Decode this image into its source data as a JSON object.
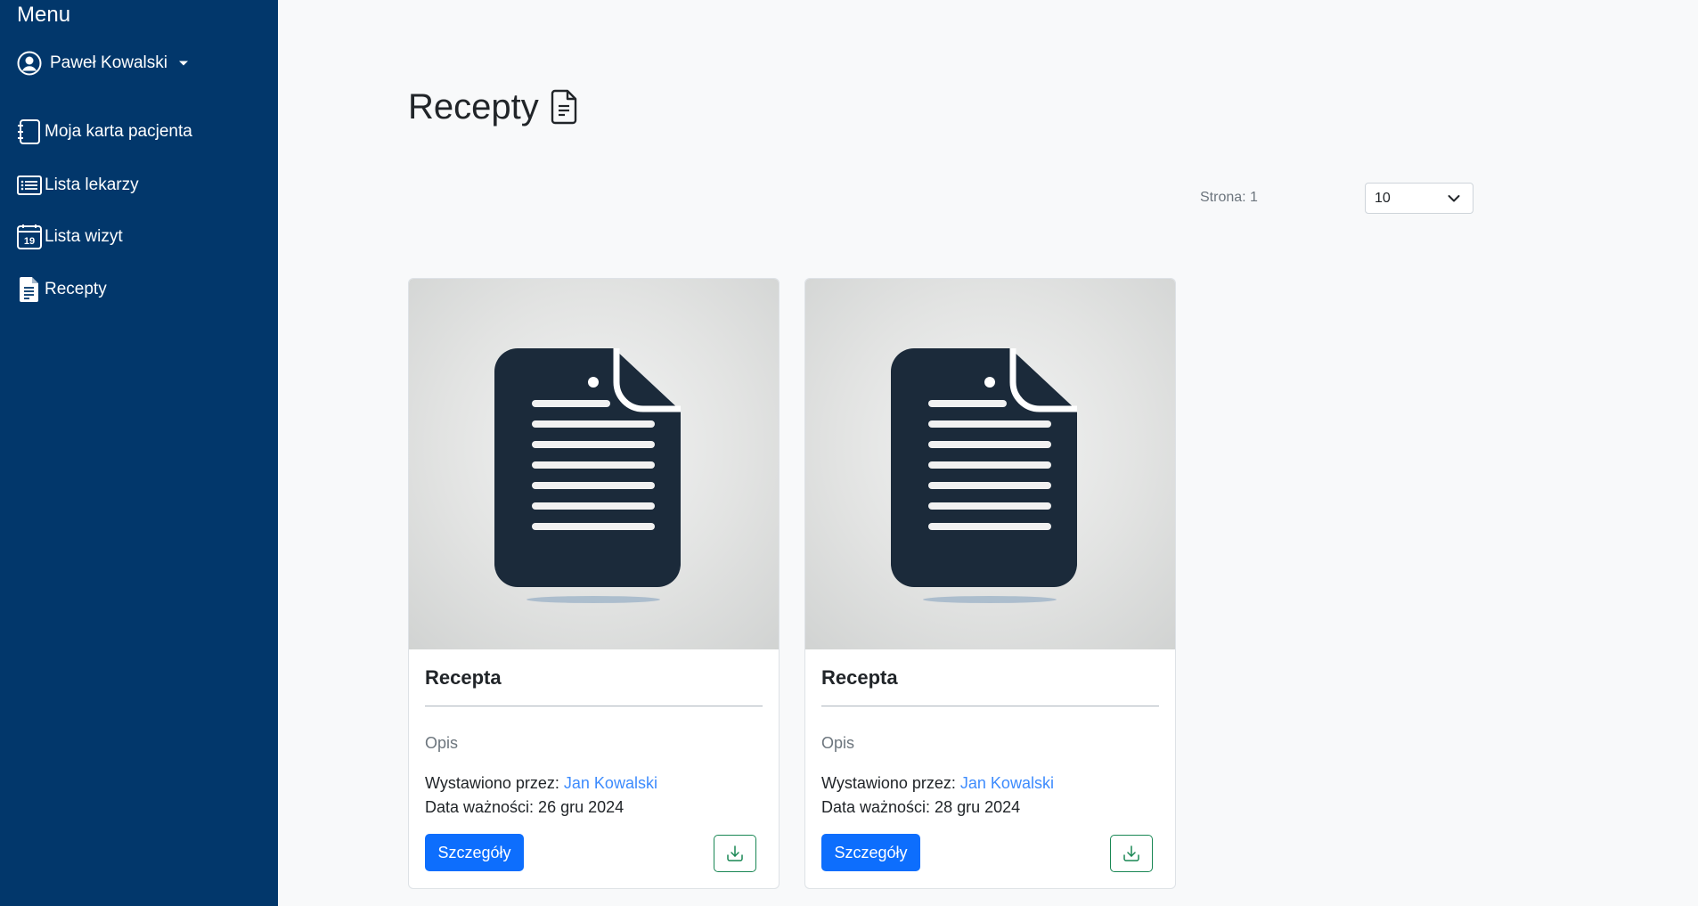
{
  "sidebar": {
    "title": "Menu",
    "user": {
      "name": "Paweł Kowalski"
    },
    "items": [
      {
        "label": "Moja karta pacjenta",
        "icon": "journal-icon"
      },
      {
        "label": "Lista lekarzy",
        "icon": "list-icon"
      },
      {
        "label": "Lista wizyt",
        "icon": "calendar-icon",
        "icon_text": "19"
      },
      {
        "label": "Recepty",
        "icon": "file-text-icon"
      }
    ]
  },
  "main": {
    "title": "Recepty",
    "title_icon": "file-text-icon",
    "pagination": {
      "page_label": "Strona: 1",
      "page_size": "10"
    },
    "prescriptions": [
      {
        "title": "Recepta",
        "description": "Opis",
        "issued_by_label": "Wystawiono przez:",
        "doctor": "Jan Kowalski",
        "expiry": "Data ważności: 26 gru 2024",
        "details_label": "Szczegóły",
        "download_icon": "download-icon"
      },
      {
        "title": "Recepta",
        "description": "Opis",
        "issued_by_label": "Wystawiono przez:",
        "doctor": "Jan Kowalski",
        "expiry": "Data ważności: 28 gru 2024",
        "details_label": "Szczegóły",
        "download_icon": "download-icon"
      }
    ]
  },
  "colors": {
    "sidebar_bg": "#02376b",
    "primary": "#0d6efd",
    "link": "#3d8bfd",
    "success_outline": "#198754",
    "page_bg": "#f8f9fa"
  }
}
